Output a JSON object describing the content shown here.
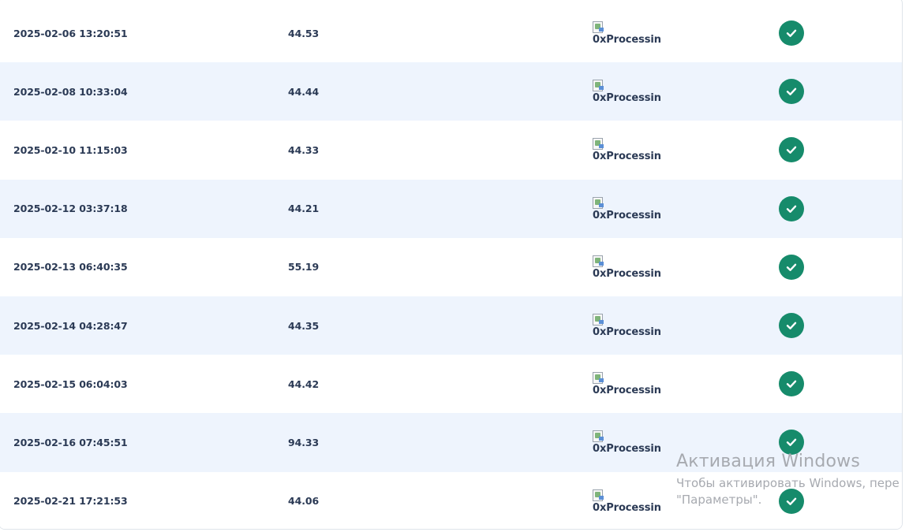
{
  "transactions": [
    {
      "date": "2025-02-06 13:20:51",
      "amount": "44.53",
      "processor_alt": "0xProcessin",
      "status_icon": "check-circle-icon"
    },
    {
      "date": "2025-02-08 10:33:04",
      "amount": "44.44",
      "processor_alt": "0xProcessin",
      "status_icon": "check-circle-icon"
    },
    {
      "date": "2025-02-10 11:15:03",
      "amount": "44.33",
      "processor_alt": "0xProcessin",
      "status_icon": "check-circle-icon"
    },
    {
      "date": "2025-02-12 03:37:18",
      "amount": "44.21",
      "processor_alt": "0xProcessin",
      "status_icon": "check-circle-icon"
    },
    {
      "date": "2025-02-13 06:40:35",
      "amount": "55.19",
      "processor_alt": "0xProcessin",
      "status_icon": "check-circle-icon"
    },
    {
      "date": "2025-02-14 04:28:47",
      "amount": "44.35",
      "processor_alt": "0xProcessin",
      "status_icon": "check-circle-icon"
    },
    {
      "date": "2025-02-15 06:04:03",
      "amount": "44.42",
      "processor_alt": "0xProcessin",
      "status_icon": "check-circle-icon"
    },
    {
      "date": "2025-02-16 07:45:51",
      "amount": "94.33",
      "processor_alt": "0xProcessin",
      "status_icon": "check-circle-icon"
    },
    {
      "date": "2025-02-21 17:21:53",
      "amount": "44.06",
      "processor_alt": "0xProcessin",
      "status_icon": "check-circle-icon"
    }
  ],
  "colors": {
    "text": "#2b3a55",
    "row_alt_bg": "#eef4fd",
    "status_success": "#168b6b",
    "watermark": "#a7aab0"
  },
  "watermark": {
    "title": "Активация Windows",
    "line1": "Чтобы активировать Windows, пере",
    "line2": "\"Параметры\"."
  }
}
